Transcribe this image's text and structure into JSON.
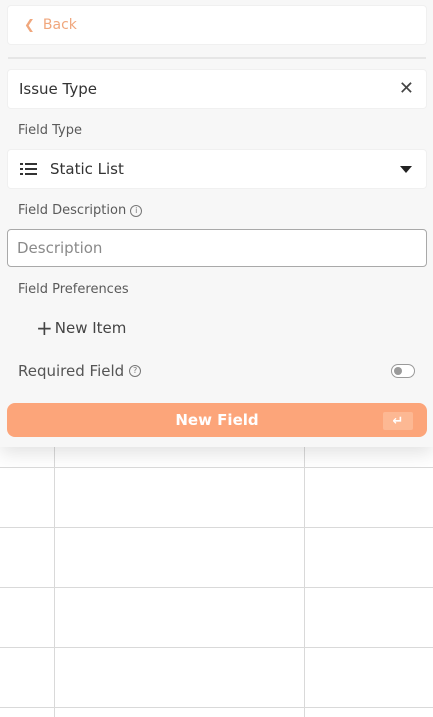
{
  "back": {
    "label": "Back"
  },
  "issue": {
    "title": "Issue Type"
  },
  "field_type": {
    "label": "Field Type",
    "selected": "Static List",
    "icon": "list-icon"
  },
  "field_description": {
    "label": "Field Description",
    "placeholder": "Description",
    "value": ""
  },
  "field_preferences": {
    "label": "Field Preferences",
    "new_item_label": "New Item"
  },
  "required_field": {
    "label": "Required Field",
    "enabled": false
  },
  "submit": {
    "label": "New Field"
  },
  "colors": {
    "accent": "#fca57a",
    "back_link": "#f0a77d"
  }
}
